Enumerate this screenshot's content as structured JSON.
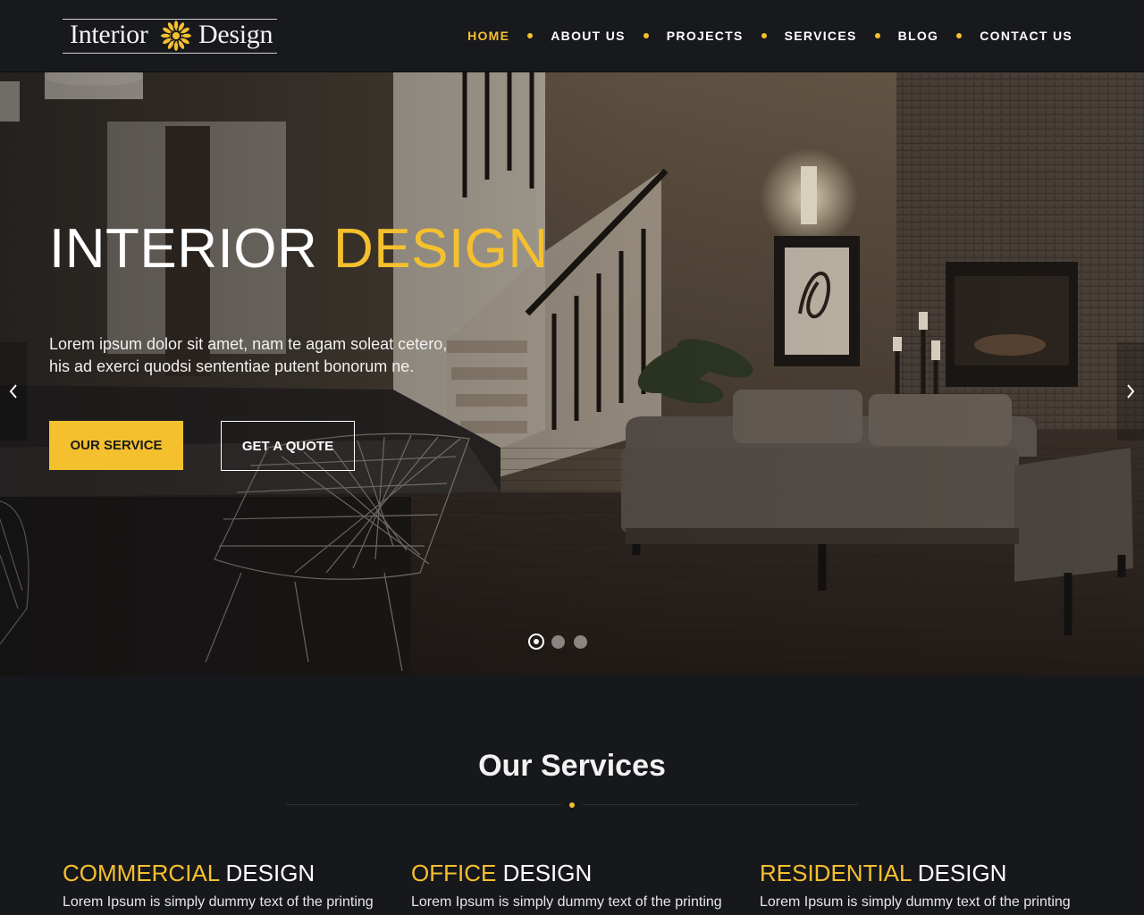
{
  "header": {
    "logo": {
      "word1": "Interior",
      "word2": "Design"
    },
    "nav": [
      {
        "label": "HOME",
        "active": true
      },
      {
        "label": "ABOUT US",
        "active": false
      },
      {
        "label": "PROJECTS",
        "active": false
      },
      {
        "label": "SERVICES",
        "active": false
      },
      {
        "label": "BLOG",
        "active": false
      },
      {
        "label": "CONTACT US",
        "active": false
      }
    ]
  },
  "hero": {
    "title_part1": "INTERIOR",
    "title_part2": "DESIGN",
    "text_line1": "Lorem ipsum dolor sit amet, nam te agam soleat cetero,",
    "text_line2": "his ad exerci quodsi sententiae putent bonorum ne.",
    "primary_button": "OUR SERVICE",
    "secondary_button": "GET A QUOTE",
    "prev_icon": "chevron-left-icon",
    "next_icon": "chevron-right-icon",
    "slides_total": 3,
    "active_slide": 1
  },
  "services": {
    "title": "Our Services",
    "items": [
      {
        "highlight": "COMMERCIAL",
        "rest": "DESIGN",
        "text": "Lorem Ipsum is simply dummy text of the printing"
      },
      {
        "highlight": "OFFICE",
        "rest": "DESIGN",
        "text": "Lorem Ipsum is simply dummy text of the printing"
      },
      {
        "highlight": "RESIDENTIAL",
        "rest": "DESIGN",
        "text": "Lorem Ipsum is simply dummy text of the printing"
      }
    ]
  },
  "colors": {
    "accent": "#f5c02e",
    "background": "#17181c",
    "header": "#18191d"
  }
}
